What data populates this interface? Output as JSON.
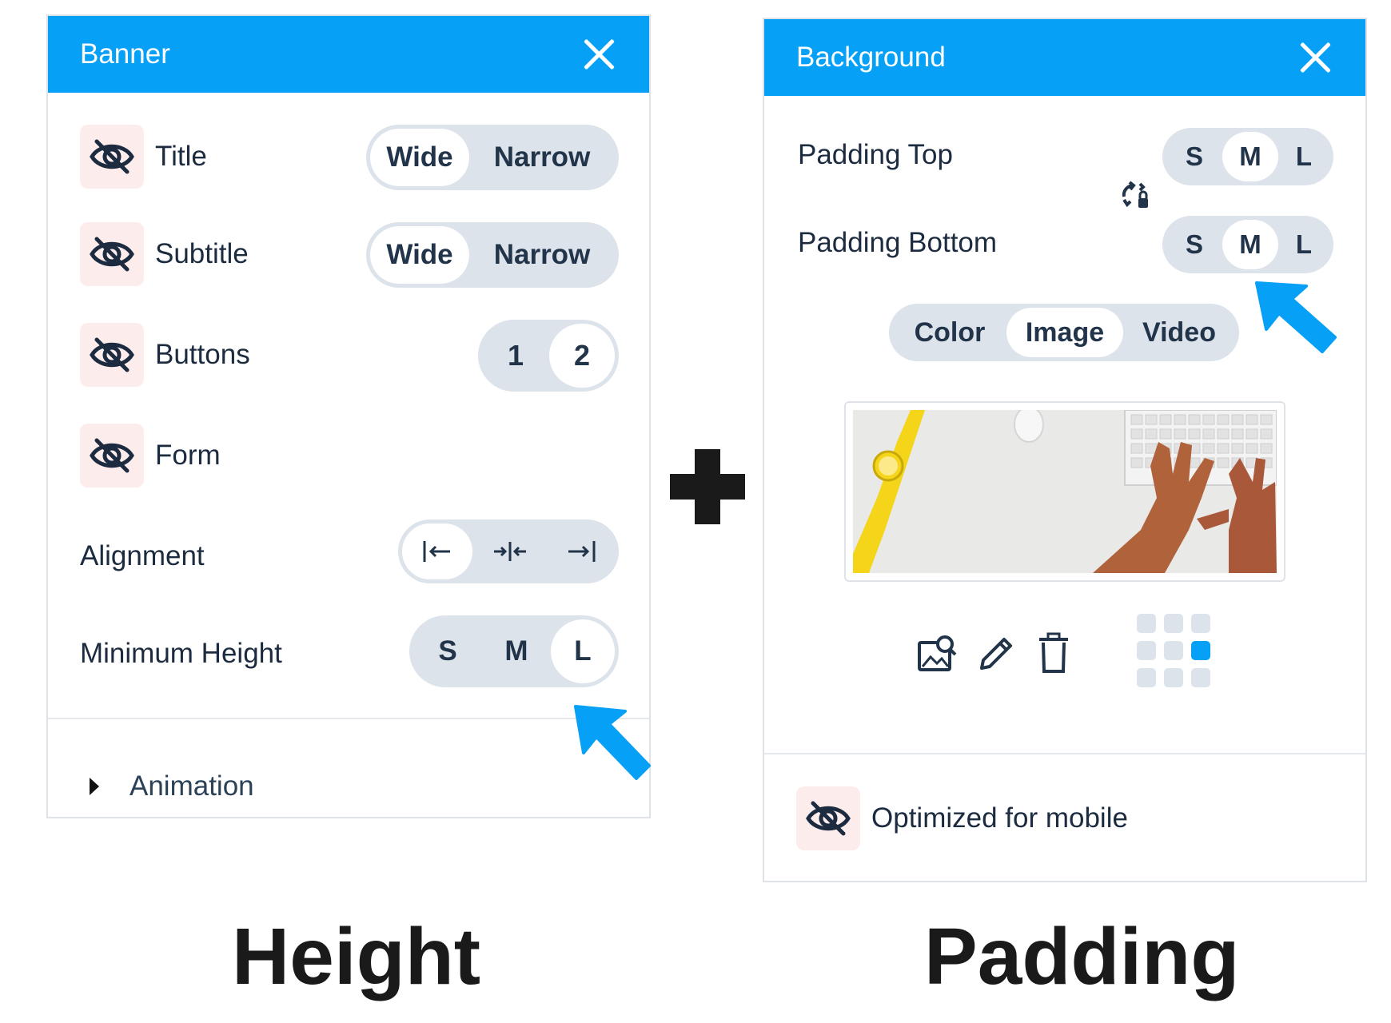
{
  "banner": {
    "title": "Banner",
    "rows": [
      {
        "label": "Title",
        "options": [
          "Wide",
          "Narrow"
        ],
        "selected": 0
      },
      {
        "label": "Subtitle",
        "options": [
          "Wide",
          "Narrow"
        ],
        "selected": 0
      },
      {
        "label": "Buttons",
        "options": [
          "1",
          "2"
        ],
        "selected": 1
      },
      {
        "label": "Form"
      }
    ],
    "alignment": {
      "label": "Alignment",
      "options": [
        "align-left-icon",
        "align-center-icon",
        "align-right-icon"
      ],
      "selected": 0
    },
    "min_height": {
      "label": "Minimum Height",
      "options": [
        "S",
        "M",
        "L"
      ],
      "selected": 2
    },
    "animation_label": "Animation"
  },
  "background": {
    "title": "Background",
    "padding_top": {
      "label": "Padding Top",
      "options": [
        "S",
        "M",
        "L"
      ],
      "selected": 1
    },
    "padding_bottom": {
      "label": "Padding Bottom",
      "options": [
        "S",
        "M",
        "L"
      ],
      "selected": 1
    },
    "type": {
      "options": [
        "Color",
        "Image",
        "Video"
      ],
      "selected": 1
    },
    "image_alt": "desk with keyboard, hands and yellow watch",
    "tools": [
      "image-search-icon",
      "pencil-icon",
      "trash-icon"
    ],
    "position_grid_selected": 5,
    "mobile_label": "Optimized for mobile"
  },
  "captions": {
    "left": "Height",
    "right": "Padding"
  },
  "colors": {
    "accent": "#06a0f6",
    "header_text": "#ffffff",
    "eye_bg": "#fdecec",
    "segment_bg": "#dde3ea"
  }
}
